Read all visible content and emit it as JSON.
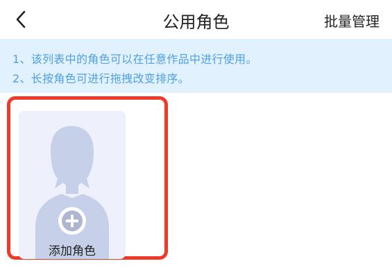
{
  "header": {
    "title": "公用角色",
    "manage_label": "批量管理"
  },
  "notice": {
    "line1": "1、该列表中的角色可以在任意作品中进行使用。",
    "line2": "2、长按角色可进行拖拽改变排序。"
  },
  "add_card": {
    "label": "添加角色",
    "icon": "plus-circle-icon"
  },
  "colors": {
    "notice_text": "#4f9fe4",
    "notice_bg": "#e1f1fd",
    "highlight_border": "#ee3a26",
    "silhouette": "#c6d0e8"
  }
}
